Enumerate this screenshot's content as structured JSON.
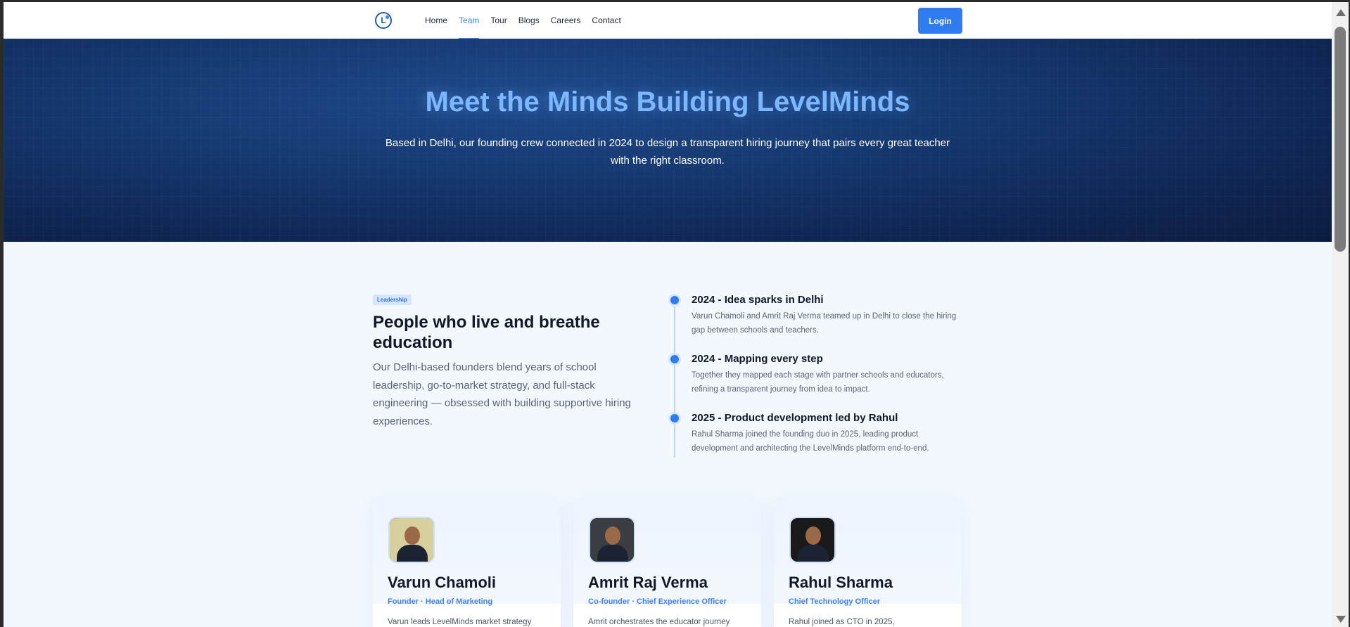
{
  "nav": {
    "items": [
      {
        "label": "Home",
        "active": false
      },
      {
        "label": "Team",
        "active": true
      },
      {
        "label": "Tour",
        "active": false
      },
      {
        "label": "Blogs",
        "active": false
      },
      {
        "label": "Careers",
        "active": false
      },
      {
        "label": "Contact",
        "active": false
      }
    ],
    "login_label": "Login"
  },
  "hero": {
    "title": "Meet the Minds Building LevelMinds",
    "subtitle": "Based in Delhi, our founding crew connected in 2024 to design a transparent hiring journey that pairs every great teacher with the right classroom."
  },
  "about": {
    "tag": "Leadership",
    "title": "People who live and breathe education",
    "text": "Our Delhi-based founders blend years of school leadership, go-to-market strategy, and full-stack engineering — obsessed with building supportive hiring experiences."
  },
  "timeline": [
    {
      "title": "2024 - Idea sparks in Delhi",
      "text": "Varun Chamoli and Amrit Raj Verma teamed up in Delhi to close the hiring gap between schools and teachers."
    },
    {
      "title": "2024 - Mapping every step",
      "text": "Together they mapped each stage with partner schools and educators, refining a transparent journey from idea to impact."
    },
    {
      "title": "2025 - Product development led by Rahul",
      "text": "Rahul Sharma joined the founding duo in 2025, leading product development and architecting the LevelMinds platform end-to-end."
    }
  ],
  "team": [
    {
      "name": "Varun Chamoli",
      "role": "Founder · Head of Marketing",
      "text": "Varun leads LevelMinds market strategy",
      "avatar_bg": "#d8cf9e"
    },
    {
      "name": "Amrit Raj Verma",
      "role": "Co-founder · Chief Experience Officer",
      "text": "Amrit orchestrates the educator journey",
      "avatar_bg": "#3a3d42"
    },
    {
      "name": "Rahul Sharma",
      "role": "Chief Technology Officer",
      "text": "Rahul joined as CTO in 2025,",
      "avatar_bg": "#1a1a1a"
    }
  ],
  "colors": {
    "accent": "#2f7cf0",
    "hero_title": "#7cb7ff",
    "hero_bg": "#163a73"
  }
}
